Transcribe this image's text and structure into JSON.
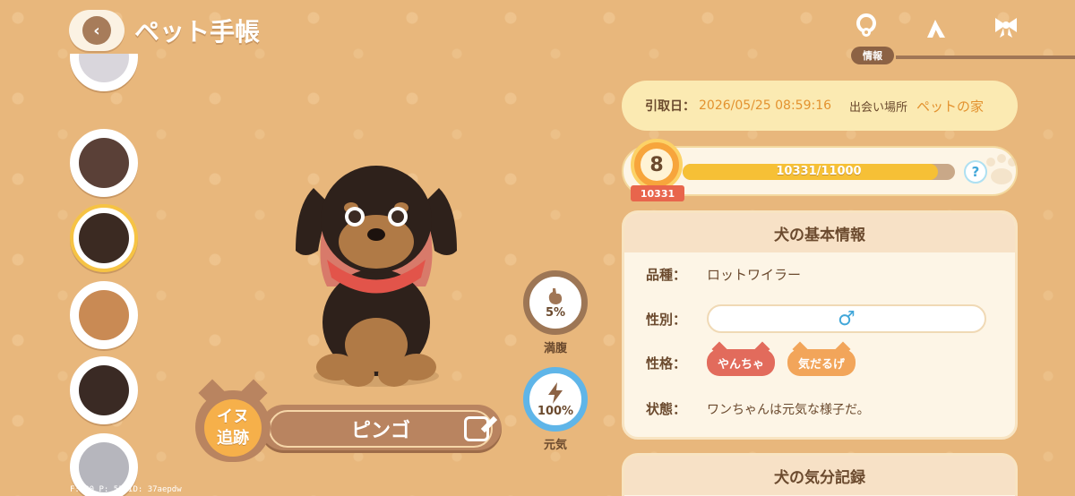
{
  "header": {
    "title": "ペット手帳",
    "tabs": [
      {
        "name": "info",
        "icon": "collar-icon",
        "active": true
      },
      {
        "name": "skills",
        "icon": "lambda-icon"
      },
      {
        "name": "accessories",
        "icon": "ribbon-icon"
      }
    ],
    "active_tab_label": "情報"
  },
  "pets": [
    {
      "name": "white-cat",
      "color": "#d9d6dc",
      "active": false
    },
    {
      "name": "black-cat",
      "color": "#5a4037",
      "active": false
    },
    {
      "name": "rottweiler",
      "color": "#3b2a22",
      "active": true
    },
    {
      "name": "calico-cat",
      "color": "#c98a54",
      "active": false
    },
    {
      "name": "pug-dog",
      "color": "#3a2a24",
      "active": false
    },
    {
      "name": "grey-cat-ribbon",
      "color": "#b6b6bd",
      "active": false
    }
  ],
  "pet": {
    "name": "ピンゴ",
    "track_label_1": "イヌ",
    "track_label_2": "追跡"
  },
  "gauges": {
    "hunger": {
      "value": "5%",
      "label": "満腹",
      "fraction": 0.05
    },
    "energy": {
      "value": "100%",
      "label": "元気",
      "fraction": 1.0
    }
  },
  "adoption": {
    "date_label": "引取日：",
    "date_value": "2026/05/25 08:59:16",
    "place_label": "出会い場所",
    "place_value": "ペットの家"
  },
  "level": {
    "level": "8",
    "xp_text": "10331/11000",
    "xp_fraction": 0.939,
    "xp_badge": "10331",
    "help": "?"
  },
  "basic_info": {
    "title": "犬の基本情報",
    "breed_label": "品種：",
    "breed_value": "ロットワイラー",
    "gender_label": "性別：",
    "gender_value": "♂",
    "personality_label": "性格：",
    "traits": [
      "やんちゃ",
      "気だるげ"
    ],
    "status_label": "状態：",
    "status_value": "ワンちゃんは元気な様子だ。"
  },
  "mood": {
    "title": "犬の気分記録"
  },
  "debug": "F: 30    P: 53    ID: 37aepdw"
}
